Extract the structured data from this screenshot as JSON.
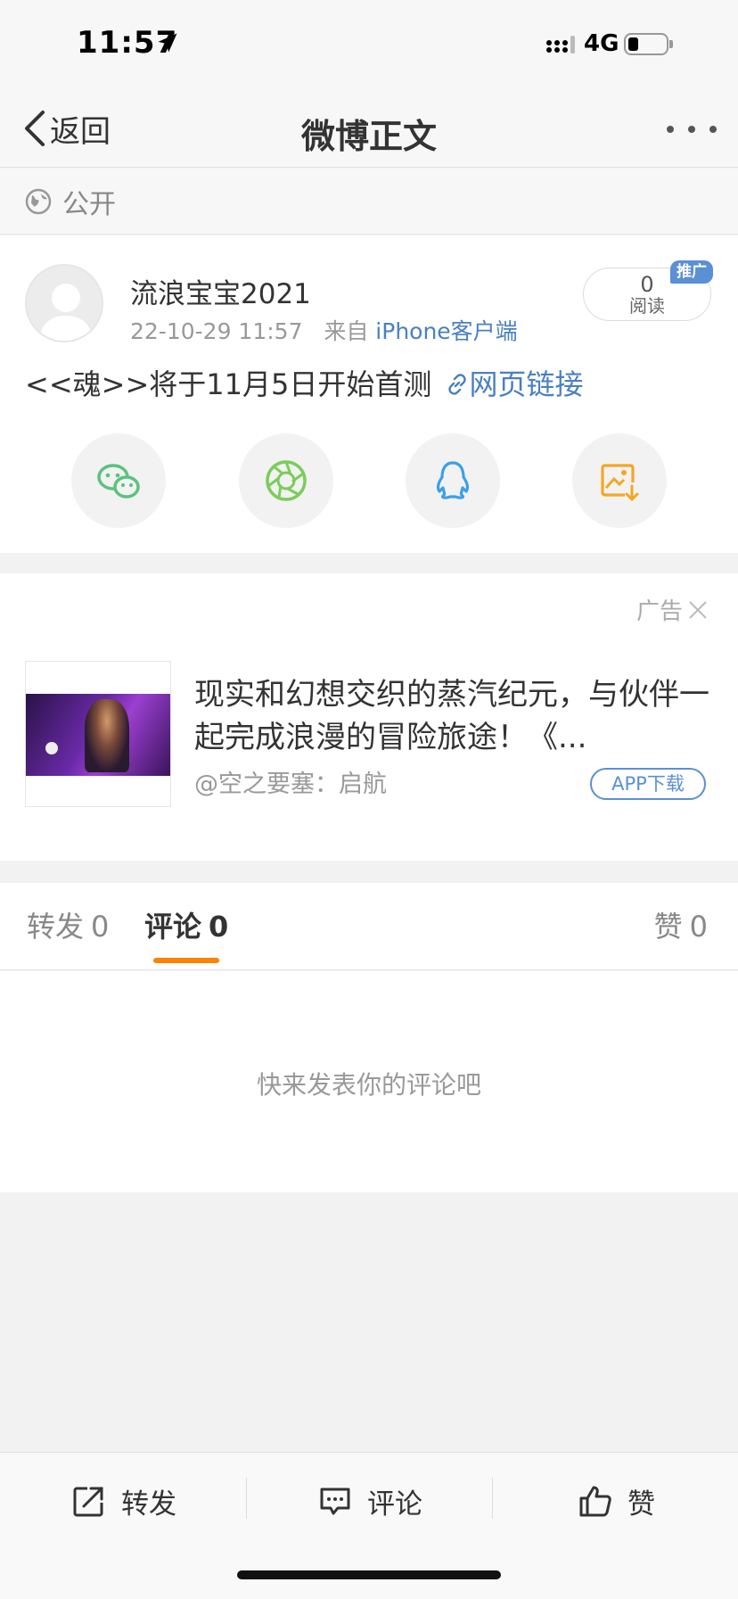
{
  "status_bar": {
    "time": "11:57",
    "network": "4G"
  },
  "nav": {
    "back_label": "返回",
    "title": "微博正文"
  },
  "visibility": {
    "label": "公开"
  },
  "post": {
    "username": "流浪宝宝2021",
    "datetime": "22-10-29 11:57",
    "from_label": "来自",
    "source": "iPhone客户端",
    "read_count": "0",
    "read_label": "阅读",
    "promo_badge": "推广",
    "text": "<<魂>>将于11月5日开始首测",
    "link_text": "网页链接",
    "share_targets": [
      "wechat-icon",
      "moments-icon",
      "qq-icon",
      "save-image-icon"
    ]
  },
  "ad": {
    "label": "广告",
    "title": "现实和幻想交织的蒸汽纪元，与伙伴一起完成浪漫的冒险旅途！《...",
    "source": "@空之要塞：启航",
    "cta": "APP下载"
  },
  "tabs": {
    "repost_label": "转发",
    "repost_count": "0",
    "comment_label": "评论",
    "comment_count": "0",
    "like_label": "赞",
    "like_count": "0"
  },
  "comments": {
    "empty_text": "快来发表你的评论吧"
  },
  "bottom_bar": {
    "repost": "转发",
    "comment": "评论",
    "like": "赞"
  },
  "colors": {
    "link": "#4a80c0",
    "accent": "#ff8200",
    "promo": "#5b8fd6"
  }
}
